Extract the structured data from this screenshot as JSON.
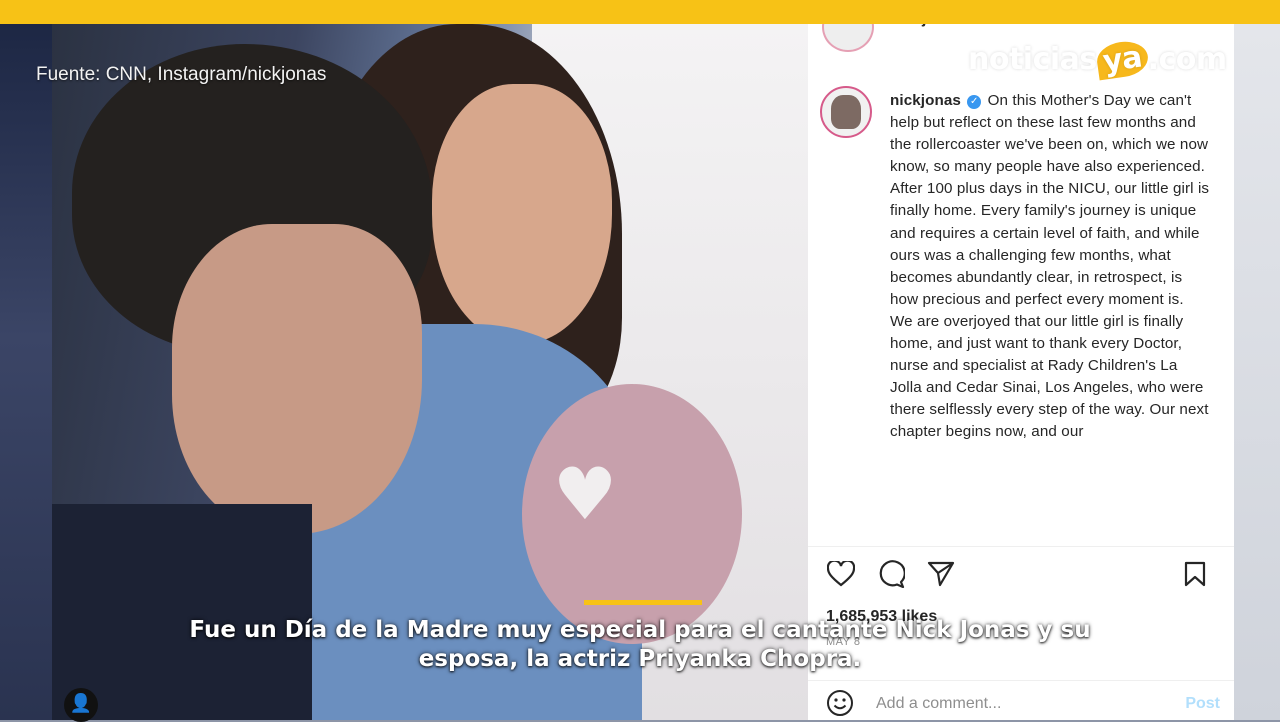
{
  "video": {
    "source_credit": "Fuente: CNN, Instagram/nickjonas",
    "subtitle_line1": "Fue un Día de la Madre muy especial para el cantante Nick Jonas y su",
    "subtitle_line2": "esposa, la actriz Priyanka Chopra.",
    "accent_color": "#f7c216"
  },
  "logo": {
    "part1": "noticias",
    "part2": "ya",
    "part3": ".com"
  },
  "instagram": {
    "prev_username": "nickjonas",
    "username": "nickjonas",
    "caption": "On this Mother's Day we can't help but reflect on these last few months and the rollercoaster we've been on, which we now know, so many people have also experienced. After 100 plus days in the NICU, our little girl is finally home. Every family's journey is unique and requires a certain level of faith, and while ours was a challenging few months, what becomes abundantly clear, in retrospect, is how precious and perfect every moment is. We are overjoyed that our little girl is finally home, and just want to thank every Doctor, nurse and specialist at Rady Children's La Jolla and Cedar Sinai, Los Angeles, who were there selflessly every step of the way. Our next chapter begins now, and our",
    "likes": "1,685,953 likes",
    "date": "MAY 8",
    "comment_placeholder": "Add a comment...",
    "post_label": "Post",
    "icons": [
      "heart-icon",
      "comment-icon",
      "share-icon",
      "bookmark-icon",
      "emoji-icon"
    ]
  }
}
